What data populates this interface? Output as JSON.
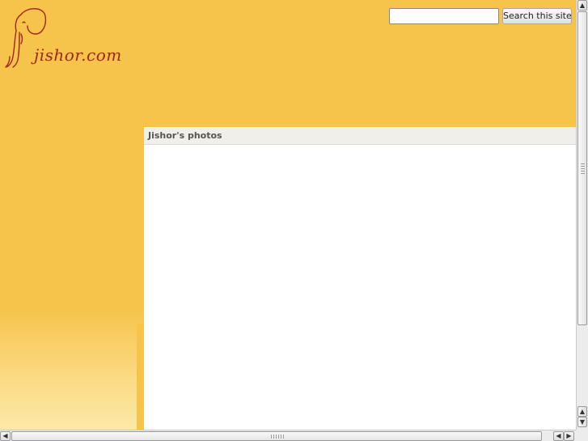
{
  "header": {
    "logo_text": "jishor.com",
    "logo_icon": "elephant-icon"
  },
  "search": {
    "input_value": "",
    "placeholder": "",
    "button_label": "Search this site"
  },
  "panel": {
    "title": "Jishor's photos"
  },
  "scrollbars": {
    "up_arrow": "▲",
    "down_arrow": "▼",
    "left_arrow": "◀",
    "right_arrow": "▶"
  },
  "colors": {
    "background": "#f6c34b",
    "background_bottom": "#fde8a8",
    "logo": "#a3261a",
    "panel": "#ffffff",
    "panel_header": "#f0efec"
  }
}
